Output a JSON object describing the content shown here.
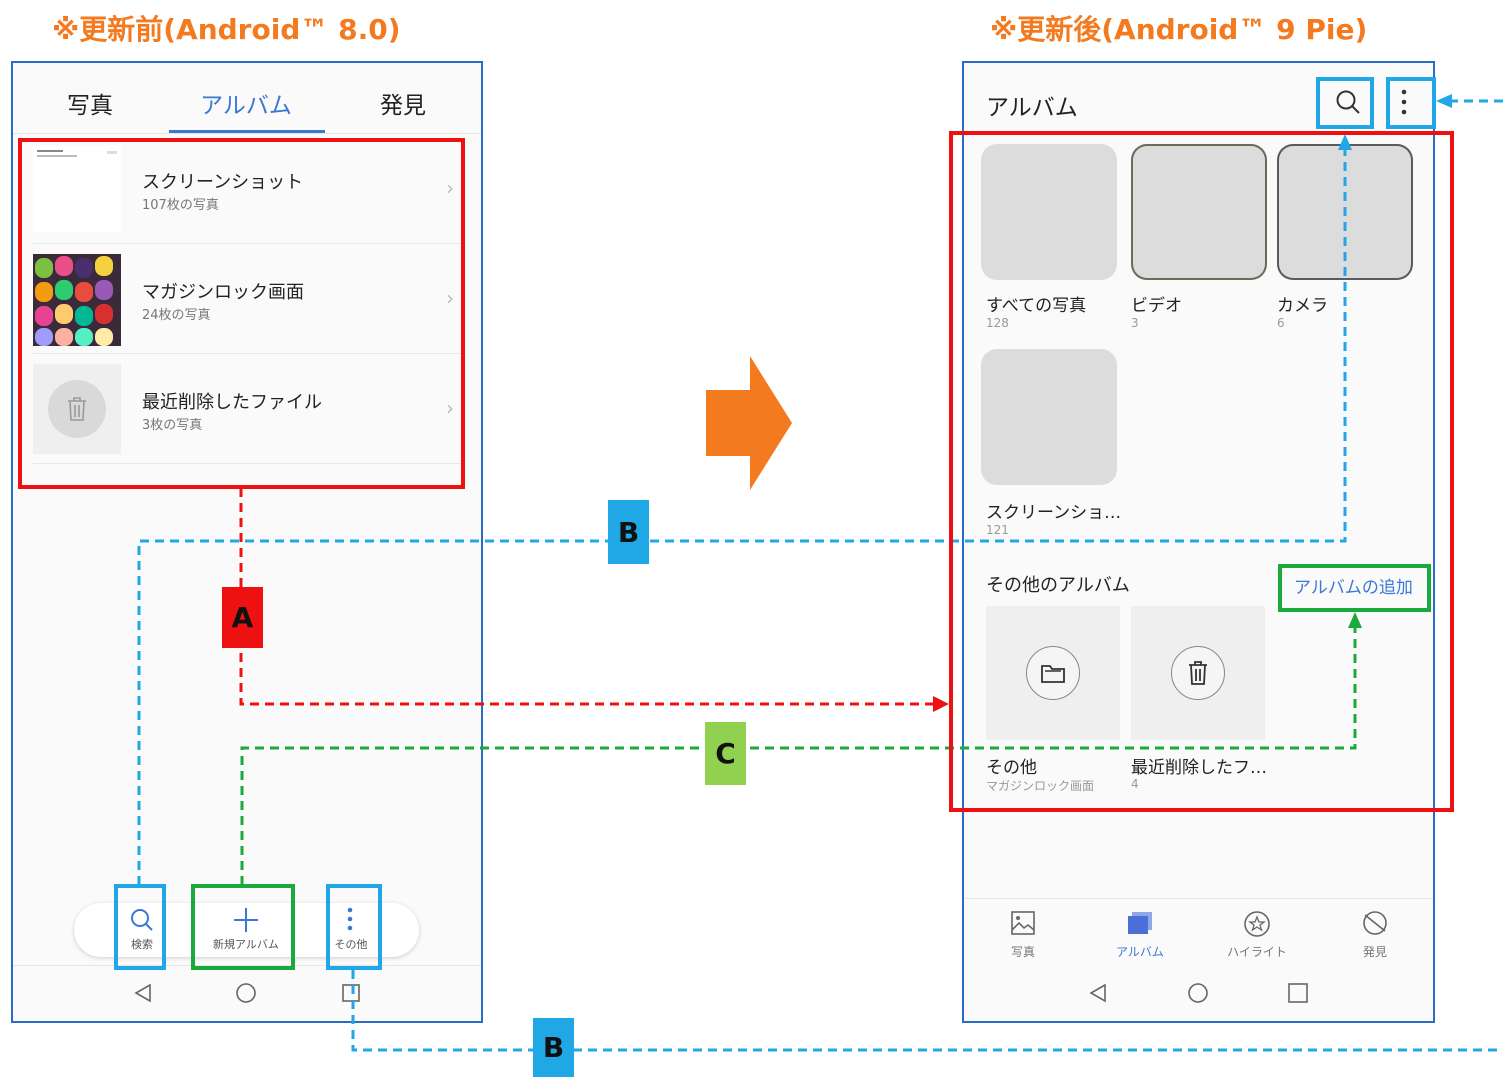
{
  "headings": {
    "before": "※更新前(Android™ 8.0)",
    "after": "※更新後(Android™ 9 Pie)"
  },
  "before": {
    "tabs": [
      "写真",
      "アルバム",
      "発見"
    ],
    "albums": [
      {
        "title": "スクリーンショット",
        "sub": "107枚の写真"
      },
      {
        "title": "マガジンロック画面",
        "sub": "24枚の写真"
      },
      {
        "title": "最近削除したファイル",
        "sub": "3枚の写真"
      }
    ],
    "bottom_buttons": [
      "検索",
      "新規アルバム",
      "その他"
    ]
  },
  "after": {
    "title": "アルバム",
    "albums": [
      {
        "name": "すべての写真",
        "count": "128"
      },
      {
        "name": "ビデオ",
        "count": "3"
      },
      {
        "name": "カメラ",
        "count": "6"
      },
      {
        "name": "スクリーンショ…",
        "count": "121"
      }
    ],
    "other_header": "その他のアルバム",
    "add_album": "アルバムの追加",
    "other_albums": [
      {
        "name": "その他",
        "count": "マガジンロック画面"
      },
      {
        "name": "最近削除したフ…",
        "count": "4"
      }
    ],
    "nav": [
      "写真",
      "アルバム",
      "ハイライト",
      "発見"
    ]
  },
  "tags": {
    "a": "A",
    "b": "B",
    "c": "C"
  },
  "colors": {
    "orange": "#f47a1f",
    "red": "#ee1111",
    "blue": "#1fa7e6",
    "green": "#1aaa3c",
    "tag_green": "#92d050",
    "accent": "#3a78d6"
  }
}
